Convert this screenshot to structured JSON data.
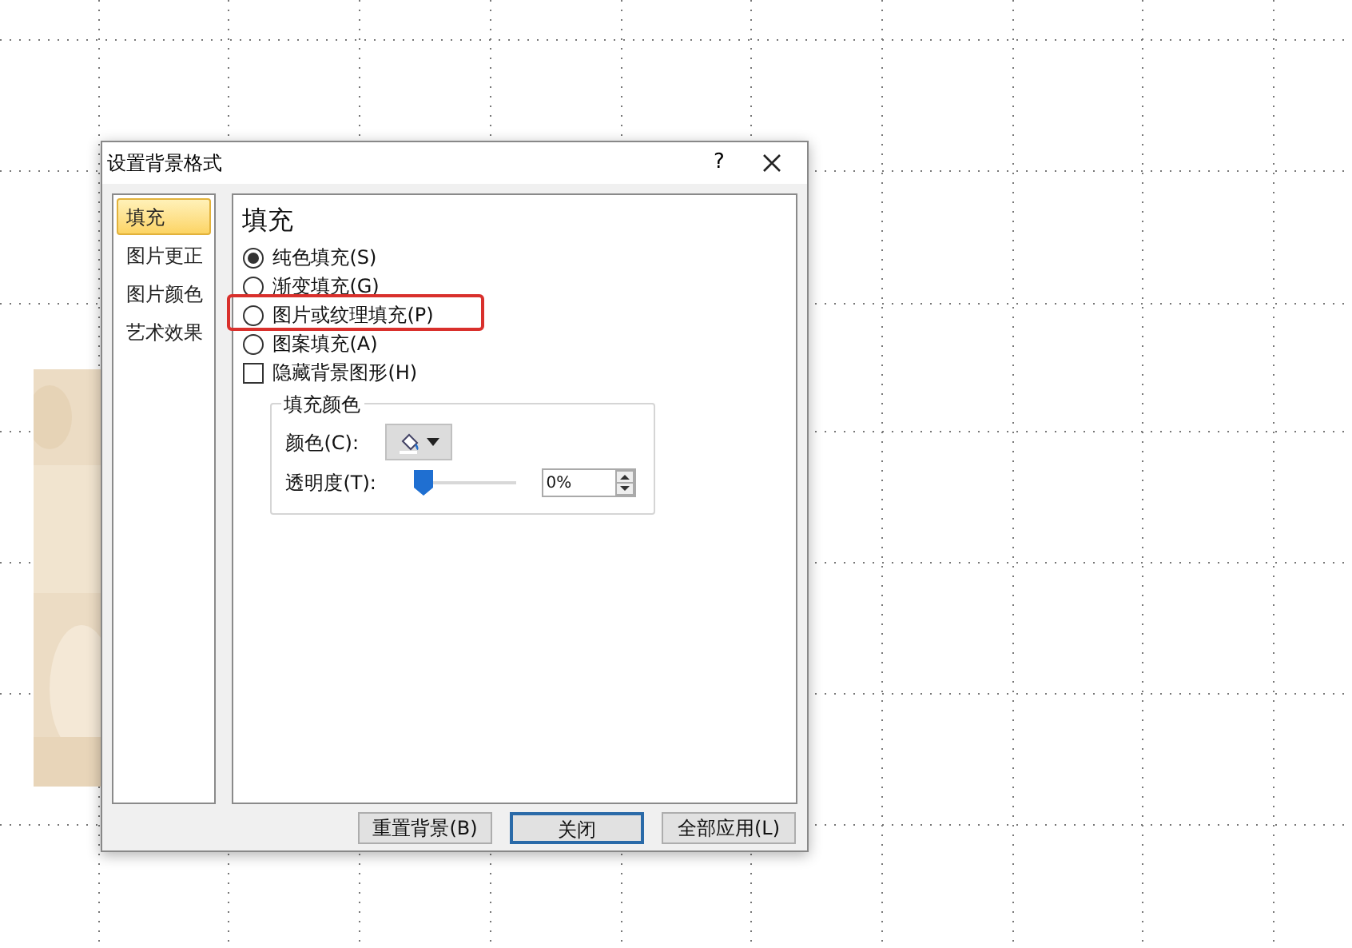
{
  "dialog": {
    "title": "设置背景格式",
    "help": "?"
  },
  "nav": [
    {
      "label": "填充",
      "selected": true
    },
    {
      "label": "图片更正",
      "selected": false
    },
    {
      "label": "图片颜色",
      "selected": false
    },
    {
      "label": "艺术效果",
      "selected": false
    }
  ],
  "panel": {
    "heading": "填充",
    "options": [
      {
        "kind": "radio",
        "label": "纯色填充(S)",
        "checked": true,
        "highlighted": false
      },
      {
        "kind": "radio",
        "label": "渐变填充(G)",
        "checked": false,
        "highlighted": false
      },
      {
        "kind": "radio",
        "label": "图片或纹理填充(P)",
        "checked": false,
        "highlighted": true
      },
      {
        "kind": "radio",
        "label": "图案填充(A)",
        "checked": false,
        "highlighted": false
      },
      {
        "kind": "checkbox",
        "label": "隐藏背景图形(H)",
        "checked": false,
        "highlighted": false
      }
    ],
    "group": {
      "title": "填充颜色",
      "color_label": "颜色(C):",
      "transparency_label": "透明度(T):",
      "transparency": {
        "level": 0.0,
        "value": "0%"
      }
    }
  },
  "buttons": [
    {
      "label": "重置背景(B)",
      "default": false
    },
    {
      "label": "关闭",
      "default": true
    },
    {
      "label": "全部应用(L)",
      "default": false
    }
  ]
}
